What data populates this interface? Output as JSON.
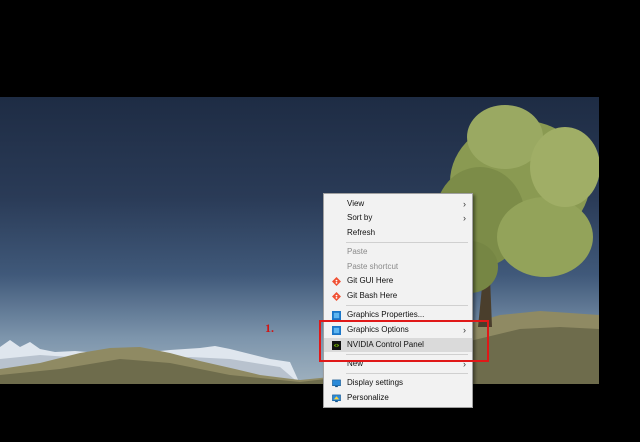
{
  "desktop": {
    "context_menu": {
      "items": [
        {
          "label": "View",
          "enabled": true,
          "submenu": true
        },
        {
          "label": "Sort by",
          "enabled": true,
          "submenu": true
        },
        {
          "label": "Refresh",
          "enabled": true
        },
        {
          "label": "Paste",
          "enabled": false
        },
        {
          "label": "Paste shortcut",
          "enabled": false
        },
        {
          "label": "Git GUI Here",
          "enabled": true,
          "icon": "git-gui-icon"
        },
        {
          "label": "Git Bash Here",
          "enabled": true,
          "icon": "git-bash-icon"
        },
        {
          "label": "Graphics Properties...",
          "enabled": true,
          "icon": "intel-graphics-icon"
        },
        {
          "label": "Graphics Options",
          "enabled": true,
          "submenu": true,
          "icon": "intel-graphics-icon"
        },
        {
          "label": "NVIDIA Control Panel",
          "enabled": true,
          "icon": "nvidia-icon",
          "hovered": true
        },
        {
          "label": "New",
          "enabled": true,
          "submenu": true
        },
        {
          "label": "Display settings",
          "enabled": true,
          "icon": "display-settings-icon"
        },
        {
          "label": "Personalize",
          "enabled": true,
          "icon": "personalize-icon"
        }
      ]
    },
    "annotation": {
      "step_label": "1.",
      "highlight_color": "#e01818"
    }
  }
}
